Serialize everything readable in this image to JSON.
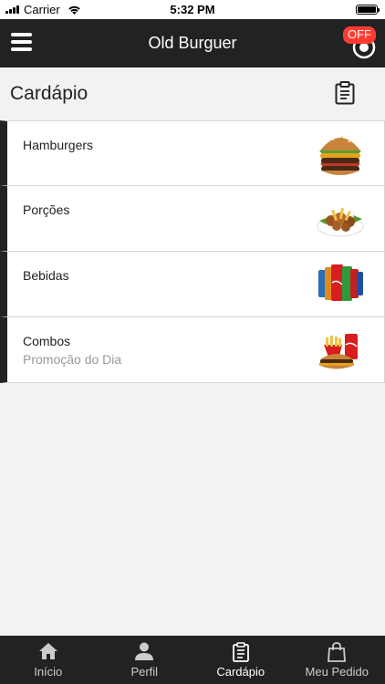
{
  "status_bar": {
    "carrier": "Carrier",
    "time": "5:32 PM"
  },
  "header": {
    "title": "Old Burguer",
    "status_badge": "OFF",
    "menu_icon": "hamburger-menu-icon"
  },
  "page": {
    "title": "Cardápio",
    "action_icon": "clipboard-icon"
  },
  "categories": [
    {
      "title": "Hamburgers",
      "subtitle": "",
      "image": "burger-photo"
    },
    {
      "title": "Porções",
      "subtitle": "",
      "image": "fried-portion-photo"
    },
    {
      "title": "Bebidas",
      "subtitle": "",
      "image": "soda-cans-photo"
    },
    {
      "title": "Combos",
      "subtitle": "Promoção do Dia",
      "image": "combo-photo"
    }
  ],
  "tabs": [
    {
      "label": "Início",
      "icon": "home-icon",
      "active": false
    },
    {
      "label": "Perfil",
      "icon": "person-icon",
      "active": false
    },
    {
      "label": "Cardápio",
      "icon": "clipboard-icon",
      "active": true
    },
    {
      "label": "Meu Pedido",
      "icon": "shopping-bag-icon",
      "active": false
    }
  ],
  "colors": {
    "header_bg": "#222222",
    "badge": "#ff3b30",
    "background": "#f2f2f2"
  }
}
